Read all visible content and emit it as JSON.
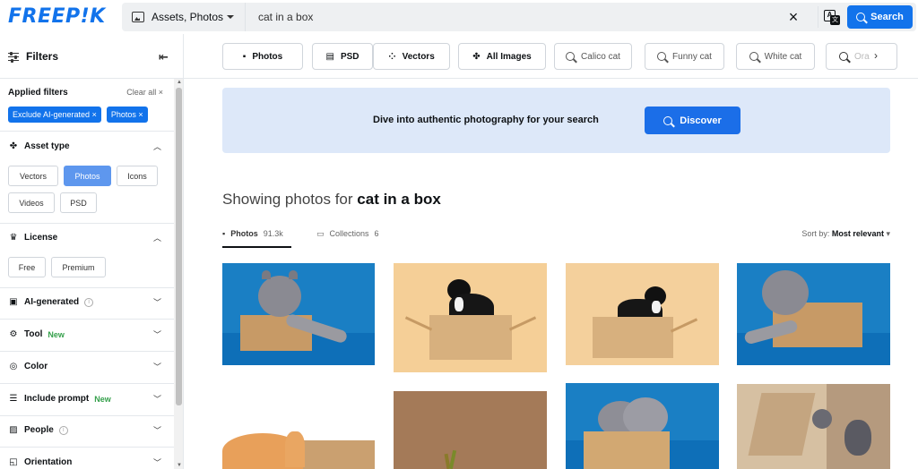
{
  "header": {
    "logo": "FREEP!K",
    "search_type": "Assets, Photos",
    "search_value": "cat in a box",
    "search_button": "Search"
  },
  "sidebar": {
    "title": "Filters",
    "applied_title": "Applied filters",
    "clear_all": "Clear all",
    "chips": [
      "Exclude AI-generated",
      "Photos"
    ],
    "asset_type": {
      "label": "Asset type",
      "options": [
        "Vectors",
        "Photos",
        "Icons",
        "Videos",
        "PSD"
      ],
      "selected": "Photos"
    },
    "license": {
      "label": "License",
      "options": [
        "Free",
        "Premium"
      ]
    },
    "sections": [
      {
        "label": "AI-generated",
        "info": true
      },
      {
        "label": "Tool",
        "badge": "New"
      },
      {
        "label": "Color"
      },
      {
        "label": "Include prompt",
        "badge": "New"
      },
      {
        "label": "People",
        "info": true
      },
      {
        "label": "Orientation"
      }
    ]
  },
  "categories": {
    "types": [
      "Photos",
      "PSD",
      "Vectors",
      "All Images"
    ],
    "suggestions": [
      "Calico cat",
      "Funny cat",
      "White cat",
      "Ora"
    ]
  },
  "banner": {
    "text": "Dive into authentic photography for your search",
    "button": "Discover"
  },
  "results": {
    "heading_prefix": "Showing photos for",
    "heading_query": "cat in a box",
    "tabs": [
      {
        "label": "Photos",
        "count": "91.3k"
      },
      {
        "label": "Collections",
        "count": "6"
      }
    ],
    "sort_label": "Sort by:",
    "sort_value": "Most relevant"
  },
  "colors": {
    "brand": "#1273eb",
    "banner_bg": "#dde8f9",
    "chip_active": "#5e97ee",
    "new_badge": "#35a04b"
  }
}
